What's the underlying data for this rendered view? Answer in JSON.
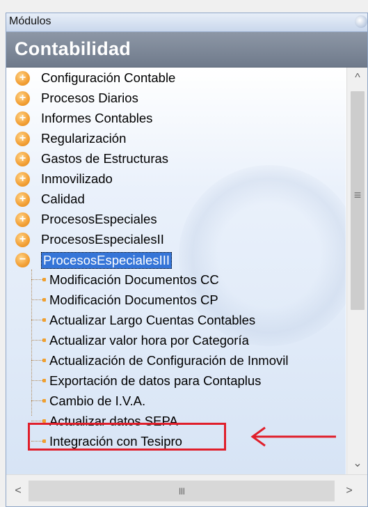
{
  "titlebar": {
    "title": "Módulos"
  },
  "header": {
    "title": "Contabilidad"
  },
  "tree": {
    "top_items": [
      {
        "label": "Configuración Contable",
        "icon": "plus-icon"
      },
      {
        "label": "Procesos Diarios",
        "icon": "plus-icon"
      },
      {
        "label": "Informes Contables",
        "icon": "plus-icon"
      },
      {
        "label": "Regularización",
        "icon": "plus-icon"
      },
      {
        "label": "Gastos de Estructuras",
        "icon": "plus-icon"
      },
      {
        "label": "Inmovilizado",
        "icon": "plus-icon"
      },
      {
        "label": "Calidad",
        "icon": "plus-icon"
      },
      {
        "label": "ProcesosEspeciales",
        "icon": "plus-icon"
      },
      {
        "label": "ProcesosEspecialesII",
        "icon": "plus-icon"
      },
      {
        "label": "ProcesosEspecialesIII",
        "icon": "minus-icon",
        "selected": true
      }
    ],
    "children": [
      {
        "label": "Modificación Documentos CC"
      },
      {
        "label": "Modificación Documentos CP"
      },
      {
        "label": "Actualizar Largo Cuentas Contables"
      },
      {
        "label": "Actualizar valor hora por Categoría"
      },
      {
        "label": "Actualización de Configuración de Inmovil"
      },
      {
        "label": "Exportación de datos para Contaplus"
      },
      {
        "label": "Cambio de I.V.A."
      },
      {
        "label": "Actualizar datos SEPA",
        "highlighted": true
      },
      {
        "label": "Integración con Tesipro"
      }
    ]
  },
  "glyphs": {
    "plus": "+",
    "minus": "−",
    "scroll_up": "^",
    "scroll_down": "⌄",
    "scroll_left": "<",
    "scroll_right": ">",
    "vgrip": "≡",
    "hgrip": "III"
  },
  "colors": {
    "highlight_border": "#e01e2a",
    "selection": "#3575d8",
    "header_bg": "#7f8a9b",
    "bullet": "#f3a23a"
  }
}
